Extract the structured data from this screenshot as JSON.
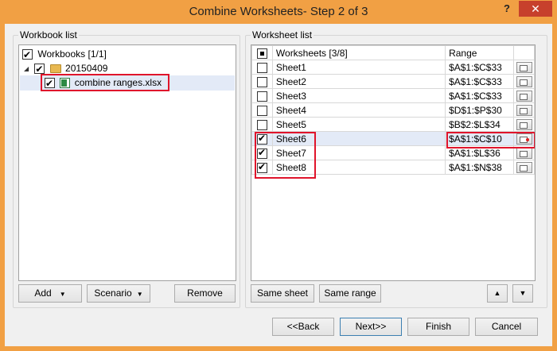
{
  "window": {
    "title": "Combine Worksheets- Step 2 of 3",
    "help_glyph": "?",
    "close_glyph": "✕"
  },
  "workbook_list": {
    "label": "Workbook list",
    "root_label": "Workbooks [1/1]",
    "folder_label": "20150409",
    "file_label": "combine ranges.xlsx",
    "add_label": "Add",
    "scenario_label": "Scenario",
    "remove_label": "Remove"
  },
  "worksheet_list": {
    "label": "Worksheet list",
    "header_name": "Worksheets [3/8]",
    "header_range": "Range",
    "rows": [
      {
        "name": "Sheet1",
        "range": "$A$1:$C$33",
        "checked": false
      },
      {
        "name": "Sheet2",
        "range": "$A$1:$C$33",
        "checked": false
      },
      {
        "name": "Sheet3",
        "range": "$A$1:$C$33",
        "checked": false
      },
      {
        "name": "Sheet4",
        "range": "$D$1:$P$30",
        "checked": false
      },
      {
        "name": "Sheet5",
        "range": "$B$2:$L$34",
        "checked": false
      },
      {
        "name": "Sheet6",
        "range": "$A$1:$C$10",
        "checked": true
      },
      {
        "name": "Sheet7",
        "range": "$A$1:$L$36",
        "checked": true
      },
      {
        "name": "Sheet8",
        "range": "$A$1:$N$38",
        "checked": true
      }
    ],
    "same_sheet_label": "Same sheet",
    "same_range_label": "Same range",
    "up_glyph": "▲",
    "down_glyph": "▼"
  },
  "footer": {
    "back_label": "<<Back",
    "next_label": "Next>>",
    "finish_label": "Finish",
    "cancel_label": "Cancel"
  },
  "colors": {
    "titlebar": "#f1a044",
    "close": "#c7402c",
    "highlight_box": "#e0142b",
    "selected_row": "#e3eaf7"
  }
}
